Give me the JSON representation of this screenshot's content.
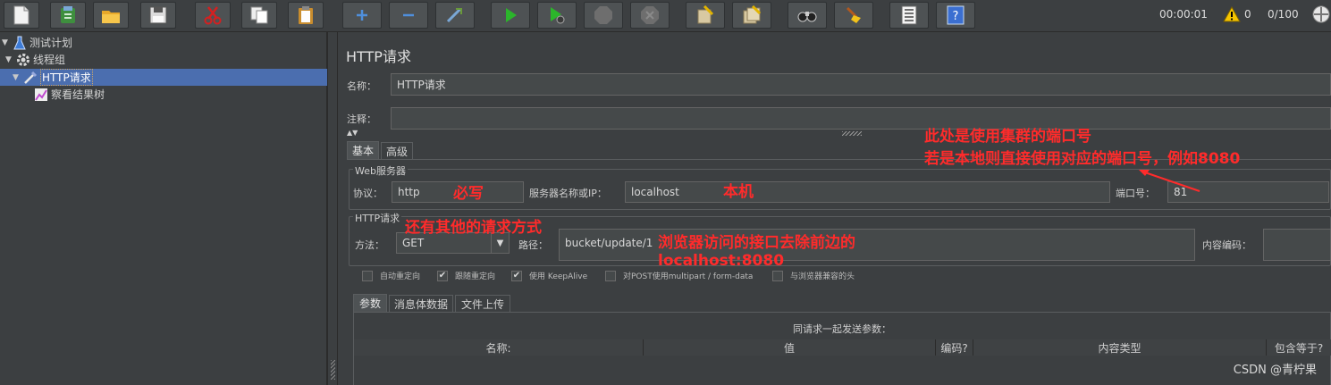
{
  "toolbar": {
    "buttons": [
      {
        "name": "new-icon"
      },
      {
        "name": "templates-icon"
      },
      {
        "name": "open-icon"
      },
      {
        "name": "save-icon"
      },
      {
        "name": "cut-icon"
      },
      {
        "name": "copy-icon"
      },
      {
        "name": "paste-icon"
      },
      {
        "name": "expand-icon"
      },
      {
        "name": "collapse-icon"
      },
      {
        "name": "toggle-icon"
      },
      {
        "name": "start-icon"
      },
      {
        "name": "start-no-pauses-icon"
      },
      {
        "name": "stop-icon"
      },
      {
        "name": "shutdown-icon"
      },
      {
        "name": "clear-icon"
      },
      {
        "name": "clear-all-icon"
      },
      {
        "name": "search-icon"
      },
      {
        "name": "reset-search-icon"
      },
      {
        "name": "function-helper-icon"
      },
      {
        "name": "help-icon"
      }
    ],
    "elapsed_time": "00:00:01",
    "warning_count": "0",
    "active_threads": "0/100"
  },
  "tree": {
    "items": [
      {
        "label": "测试计划"
      },
      {
        "label": "线程组"
      },
      {
        "label": "HTTP请求"
      },
      {
        "label": "察看结果树"
      }
    ]
  },
  "panel": {
    "title": "HTTP请求",
    "name_label": "名称：",
    "name_value": "HTTP请求",
    "comment_label": "注释：",
    "comment_value": "",
    "tabs": [
      "基本",
      "高级"
    ],
    "web_server": {
      "section_title": "Web服务器",
      "protocol_label": "协议：",
      "protocol_value": "http",
      "server_label": "服务器名称或IP：",
      "server_value": "localhost",
      "port_label": "端口号：",
      "port_value": "81"
    },
    "http_request": {
      "section_title": "HTTP请求",
      "method_label": "方法：",
      "method_value": "GET",
      "path_label": "路径：",
      "path_value": "bucket/update/1",
      "encoding_label": "内容编码：",
      "encoding_value": ""
    },
    "options": [
      {
        "label": "自动重定向",
        "checked": false
      },
      {
        "label": "跟随重定向",
        "checked": true
      },
      {
        "label": "使用 KeepAlive",
        "checked": true
      },
      {
        "label": "对POST使用multipart / form-data",
        "checked": false
      },
      {
        "label": "与浏览器兼容的头",
        "checked": false
      }
    ],
    "param_tabs": [
      "参数",
      "消息体数据",
      "文件上传"
    ],
    "params_caption": "同请求一起发送参数：",
    "columns": [
      "名称:",
      "值",
      "编码?",
      "内容类型",
      "包含等于?"
    ]
  },
  "annotations": {
    "port_note_line1": "此处是使用集群的端口号",
    "port_note_line2": "若是本地则直接使用对应的端口号，例如8080",
    "required_note": "必写",
    "local_note": "本机",
    "method_note": "还有其他的请求方式",
    "path_note_line1": "浏览器访问的接口去除前边的",
    "path_note_line2": "localhost:8080",
    "color": "#ff2b2b"
  },
  "watermark": "CSDN @青柠果"
}
